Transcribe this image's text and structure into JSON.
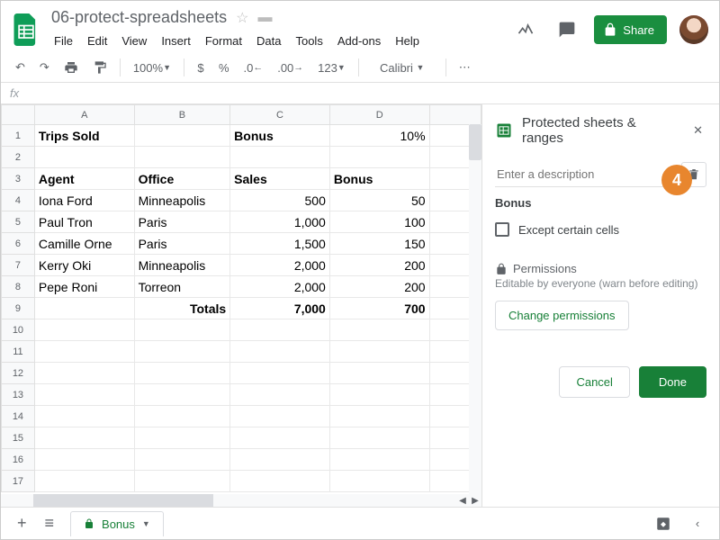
{
  "doc_title": "06-protect-spreadsheets",
  "menus": [
    "File",
    "Edit",
    "View",
    "Insert",
    "Format",
    "Data",
    "Tools",
    "Add-ons",
    "Help"
  ],
  "share_label": "Share",
  "toolbar": {
    "zoom": "100%",
    "currency": "$",
    "percent": "%",
    "dec_dec": ".0",
    "inc_dec": ".00",
    "numfmt": "123",
    "font": "Calibri",
    "more": "⋯"
  },
  "fx": "fx",
  "columns": [
    "",
    "A",
    "B",
    "C",
    "D",
    ""
  ],
  "rows": [
    {
      "n": "1",
      "cells": [
        {
          "v": "Trips Sold",
          "b": true
        },
        {
          "v": ""
        },
        {
          "v": "Bonus",
          "b": true
        },
        {
          "v": "10%",
          "r": true
        }
      ]
    },
    {
      "n": "2",
      "cells": [
        {
          "v": ""
        },
        {
          "v": ""
        },
        {
          "v": ""
        },
        {
          "v": ""
        }
      ]
    },
    {
      "n": "3",
      "cells": [
        {
          "v": "Agent",
          "b": true
        },
        {
          "v": "Office",
          "b": true
        },
        {
          "v": "Sales",
          "b": true
        },
        {
          "v": "Bonus",
          "b": true
        }
      ]
    },
    {
      "n": "4",
      "cells": [
        {
          "v": "Iona Ford"
        },
        {
          "v": "Minneapolis"
        },
        {
          "v": "500",
          "r": true
        },
        {
          "v": "50",
          "r": true
        }
      ]
    },
    {
      "n": "5",
      "cells": [
        {
          "v": "Paul Tron"
        },
        {
          "v": "Paris"
        },
        {
          "v": "1,000",
          "r": true
        },
        {
          "v": "100",
          "r": true
        }
      ]
    },
    {
      "n": "6",
      "cells": [
        {
          "v": "Camille Orne"
        },
        {
          "v": "Paris"
        },
        {
          "v": "1,500",
          "r": true
        },
        {
          "v": "150",
          "r": true
        }
      ]
    },
    {
      "n": "7",
      "cells": [
        {
          "v": "Kerry Oki"
        },
        {
          "v": "Minneapolis"
        },
        {
          "v": "2,000",
          "r": true
        },
        {
          "v": "200",
          "r": true
        }
      ]
    },
    {
      "n": "8",
      "cells": [
        {
          "v": "Pepe Roni"
        },
        {
          "v": "Torreon"
        },
        {
          "v": "2,000",
          "r": true
        },
        {
          "v": "200",
          "r": true
        }
      ]
    },
    {
      "n": "9",
      "cells": [
        {
          "v": ""
        },
        {
          "v": "Totals",
          "b": true,
          "r": true
        },
        {
          "v": "7,000",
          "b": true,
          "r": true
        },
        {
          "v": "700",
          "b": true,
          "r": true
        }
      ]
    },
    {
      "n": "10",
      "cells": [
        {
          "v": ""
        },
        {
          "v": ""
        },
        {
          "v": ""
        },
        {
          "v": ""
        }
      ]
    },
    {
      "n": "11",
      "cells": [
        {
          "v": ""
        },
        {
          "v": ""
        },
        {
          "v": ""
        },
        {
          "v": ""
        }
      ]
    },
    {
      "n": "12",
      "cells": [
        {
          "v": ""
        },
        {
          "v": ""
        },
        {
          "v": ""
        },
        {
          "v": ""
        }
      ]
    },
    {
      "n": "13",
      "cells": [
        {
          "v": ""
        },
        {
          "v": ""
        },
        {
          "v": ""
        },
        {
          "v": ""
        }
      ]
    },
    {
      "n": "14",
      "cells": [
        {
          "v": ""
        },
        {
          "v": ""
        },
        {
          "v": ""
        },
        {
          "v": ""
        }
      ]
    },
    {
      "n": "15",
      "cells": [
        {
          "v": ""
        },
        {
          "v": ""
        },
        {
          "v": ""
        },
        {
          "v": ""
        }
      ]
    },
    {
      "n": "16",
      "cells": [
        {
          "v": ""
        },
        {
          "v": ""
        },
        {
          "v": ""
        },
        {
          "v": ""
        }
      ]
    },
    {
      "n": "17",
      "cells": [
        {
          "v": ""
        },
        {
          "v": ""
        },
        {
          "v": ""
        },
        {
          "v": ""
        }
      ]
    }
  ],
  "panel": {
    "title": "Protected sheets & ranges",
    "desc_placeholder": "Enter a description",
    "range_name": "Bonus",
    "except_label": "Except certain cells",
    "perm_label": "Permissions",
    "perm_sub": "Editable by everyone (warn before editing)",
    "change_perm": "Change permissions",
    "cancel": "Cancel",
    "done": "Done"
  },
  "callout": "4",
  "sheet_tab": "Bonus"
}
